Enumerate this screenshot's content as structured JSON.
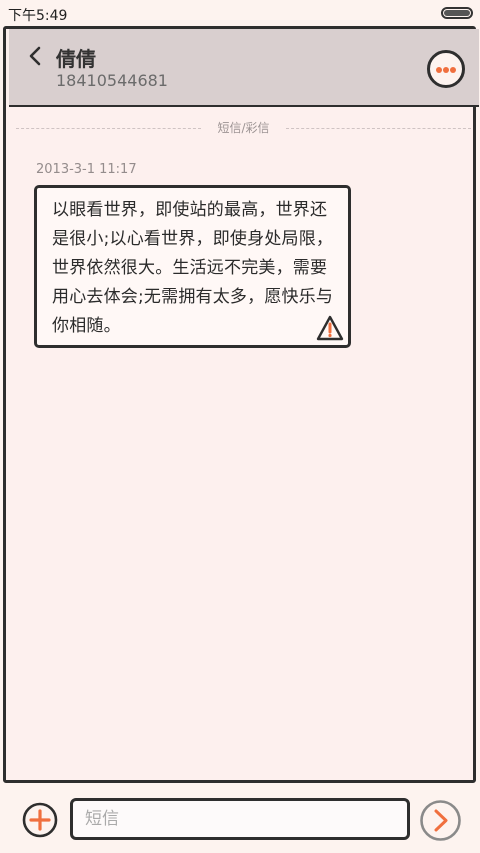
{
  "status_bar": {
    "time": "下午5:49",
    "battery_level": 1.0
  },
  "header": {
    "contact_name": "倩倩",
    "contact_number": "18410544681"
  },
  "conversation": {
    "divider_label": "短信/彩信",
    "messages": [
      {
        "timestamp": "2013-3-1 11:17",
        "text": "以眼看世界，即使站的最高，世界还是很小;以心看世界，即使身处局限，世界依然很大。生活远不完美，需要用心去体会;无需拥有太多，愿快乐与你相随。",
        "status": "warning"
      }
    ]
  },
  "compose": {
    "placeholder": "短信",
    "value": ""
  },
  "colors": {
    "accent": "#f06f3e",
    "header_bg": "#d9cfcf",
    "page_bg": "#fdf3ef",
    "outline": "#2e2e2e"
  },
  "icons": {
    "back": "back-arrow-icon",
    "more": "more-options-icon",
    "warning": "warning-triangle-icon",
    "add": "add-plus-icon",
    "send": "send-arrow-icon"
  }
}
